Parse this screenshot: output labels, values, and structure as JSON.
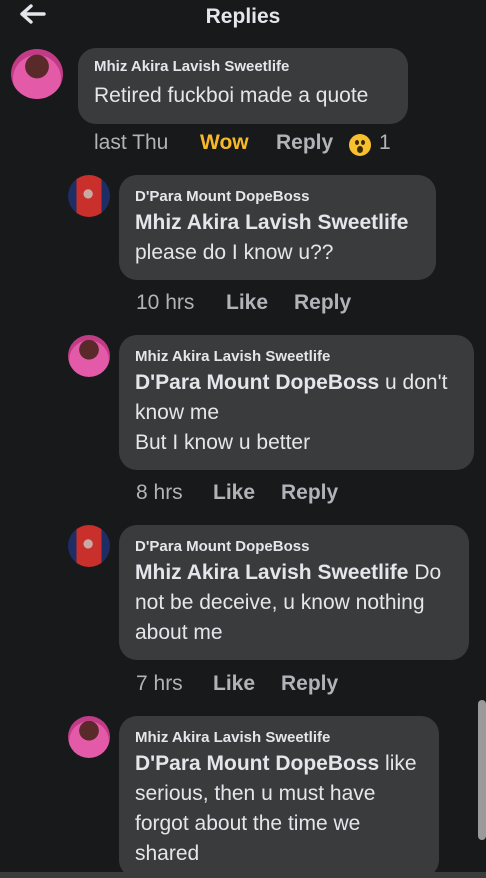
{
  "header": {
    "title": "Replies",
    "back_icon": "arrow-left-icon"
  },
  "parent": {
    "author": "Mhiz Akira Lavish Sweetlife",
    "text": "Retired fuckboi made a quote",
    "time": "last Thu",
    "reaction_label": "Wow",
    "reply_label": "Reply",
    "reaction_count": "1"
  },
  "replies": [
    {
      "author": "D'Para Mount DopeBoss",
      "mention": "Mhiz Akira Lavish Sweetlife",
      "lines": [
        "please do I know u??"
      ],
      "time": "10 hrs",
      "like": "Like",
      "reply": "Reply"
    },
    {
      "author": "Mhiz Akira Lavish Sweetlife",
      "mention": "D'Para Mount DopeBoss",
      "after_mention": " u don't",
      "lines": [
        "know me",
        "But I know u better"
      ],
      "time": "8 hrs",
      "like": "Like",
      "reply": "Reply"
    },
    {
      "author": "D'Para Mount DopeBoss",
      "mention": "Mhiz Akira Lavish Sweetlife",
      "after_mention": " Do",
      "lines": [
        "not be deceive, u know nothing",
        "about me"
      ],
      "time": "7 hrs",
      "like": "Like",
      "reply": "Reply"
    },
    {
      "author": "Mhiz Akira Lavish Sweetlife",
      "mention": "D'Para Mount DopeBoss",
      "after_mention": " like",
      "lines": [
        "serious, then u must have",
        "forgot about the time we",
        "shared"
      ]
    }
  ]
}
